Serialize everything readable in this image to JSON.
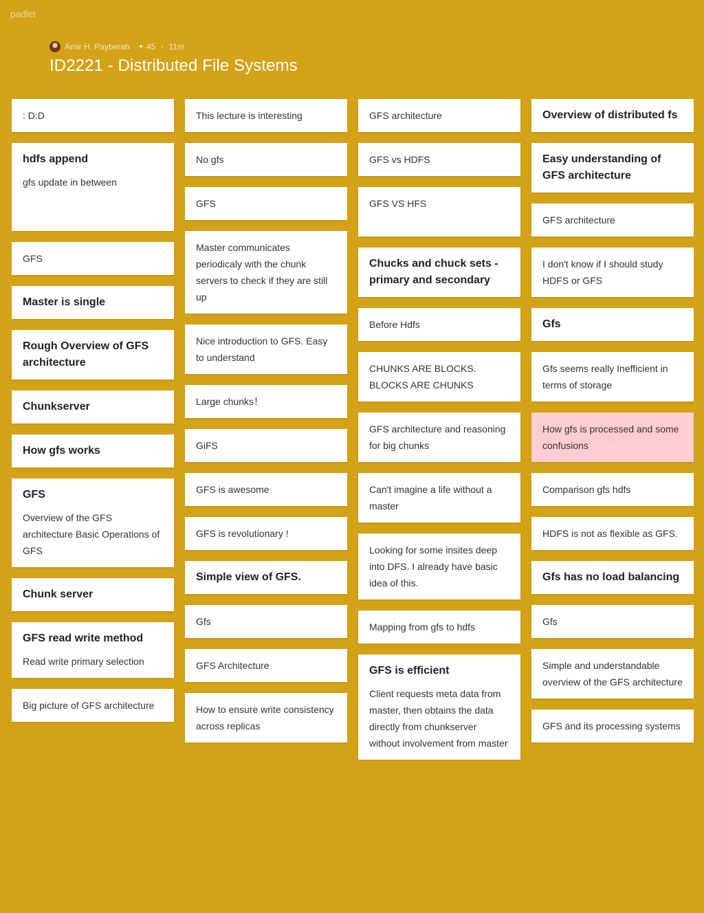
{
  "app": {
    "logo": "padlet"
  },
  "header": {
    "author": "Amir H. Payberah",
    "likes": "45",
    "time": "11m",
    "title": "ID2221 - Distributed File Systems"
  },
  "columns": [
    [
      {
        "body": ": D:D"
      },
      {
        "title": "hdfs append",
        "body": "gfs update in between",
        "min_height": 128
      },
      {
        "body": "GFS"
      },
      {
        "title": "Master is single"
      },
      {
        "title": "Rough Overview of GFS architecture"
      },
      {
        "title": "Chunkserver"
      },
      {
        "title": "How gfs works"
      },
      {
        "title": "GFS",
        "body": "Overview of the GFS architecture Basic Operations of GFS",
        "min_height": 128
      },
      {
        "title": "Chunk server"
      },
      {
        "title": "GFS read write method",
        "body": "Read write primary selection"
      },
      {
        "body": "Big picture of GFS architecture"
      }
    ],
    [
      {
        "body": "This lecture is interesting"
      },
      {
        "body": "No gfs"
      },
      {
        "body": "GFS"
      },
      {
        "body": "Master communicates periodicaly with the chunk servers to check if they are still up"
      },
      {
        "body": "Nice introduction to GFS. Easy to understand"
      },
      {
        "body": "Large chunks！"
      },
      {
        "body": "GiFS"
      },
      {
        "body": "GFS is awesome"
      },
      {
        "body": "GFS is revolutionary !"
      },
      {
        "title": "Simple view of GFS."
      },
      {
        "body": "Gfs"
      },
      {
        "body": "GFS Architecture"
      },
      {
        "body": "How to ensure write consistency across replicas"
      }
    ],
    [
      {
        "body": "GFS architecture"
      },
      {
        "body": "GFS vs HDFS"
      },
      {
        "body": "GFS VS HFS",
        "min_height": 72
      },
      {
        "title": "Chucks and chuck sets - primary and secondary"
      },
      {
        "body": "Before Hdfs"
      },
      {
        "body": "CHUNKS ARE BLOCKS. BLOCKS ARE CHUNKS"
      },
      {
        "body": "GFS architecture and reasoning for big chunks"
      },
      {
        "body": "Can't imagine a life without a master"
      },
      {
        "body": "Looking for some insites deep into DFS. I already have basic idea of this."
      },
      {
        "body": "Mapping from gfs to hdfs"
      },
      {
        "title": "GFS is efficient",
        "body": "Client requests meta data from master, then obtains the data directly from chunkserver without involvement from master"
      }
    ],
    [
      {
        "title": "Overview of distributed fs"
      },
      {
        "title": "Easy understanding of GFS architecture"
      },
      {
        "body": "GFS architecture"
      },
      {
        "body": "I don't know if I should study HDFS or GFS"
      },
      {
        "title": "Gfs"
      },
      {
        "body": "Gfs seems really Inefficient in terms of storage"
      },
      {
        "body": "How gfs is processed and some confusions",
        "color": "#FFCDD2"
      },
      {
        "body": "Comparison gfs hdfs"
      },
      {
        "body": "HDFS is not as flexible as GFS."
      },
      {
        "title": "Gfs has no load balancing"
      },
      {
        "body": "Gfs"
      },
      {
        "body": "Simple and understandable overview of the GFS architecture"
      },
      {
        "body": "GFS and its processing systems"
      }
    ]
  ],
  "colors": {
    "background": "#D4A217",
    "card": "#FFFFFF",
    "card_pink": "#FFCDD2"
  }
}
